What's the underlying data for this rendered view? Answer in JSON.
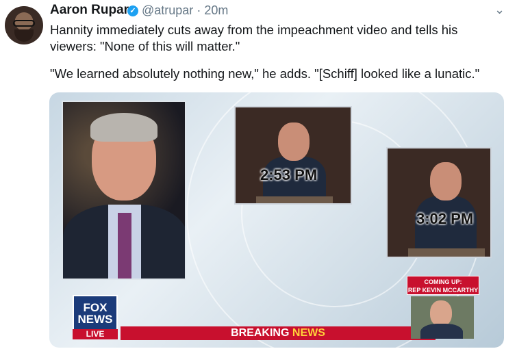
{
  "tweet": {
    "author_name": "Aaron Rupar",
    "handle": "@atrupar",
    "separator": "·",
    "time": "20m",
    "text_line1": "Hannity immediately cuts away from the impeachment video and tells his viewers: \"None of this will matter.\"",
    "text_line2": "\"We learned absolutely nothing new,\" he adds. \"[Schiff] looked like a lunatic.\""
  },
  "media": {
    "timestamp_1": "2:53 PM",
    "timestamp_2": "3:02 PM",
    "logo_line1": "FOX",
    "logo_line2": "NEWS",
    "live_label": "LIVE",
    "breaking_label": "BREAKING",
    "news_label": "NEWS",
    "coming_up_line1": "COMING UP:",
    "coming_up_line2": "REP KEVIN MCCARTHY"
  },
  "icons": {
    "verified": "verified-badge-icon",
    "menu": "chevron-down-icon"
  },
  "colors": {
    "accent": "#1da1f2",
    "fox_red": "#c8102e",
    "fox_blue": "#1b3b7a"
  }
}
